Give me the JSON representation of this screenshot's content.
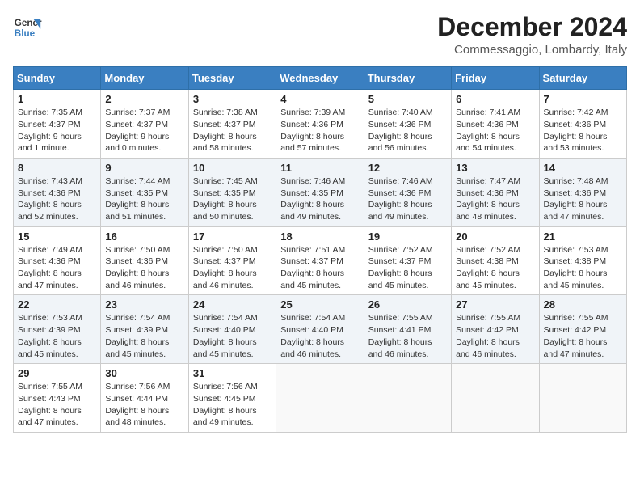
{
  "header": {
    "logo_line1": "General",
    "logo_line2": "Blue",
    "title": "December 2024",
    "subtitle": "Commessaggio, Lombardy, Italy"
  },
  "columns": [
    "Sunday",
    "Monday",
    "Tuesday",
    "Wednesday",
    "Thursday",
    "Friday",
    "Saturday"
  ],
  "weeks": [
    [
      {
        "day": "1",
        "sunrise": "7:35 AM",
        "sunset": "4:37 PM",
        "daylight": "9 hours and 1 minute."
      },
      {
        "day": "2",
        "sunrise": "7:37 AM",
        "sunset": "4:37 PM",
        "daylight": "9 hours and 0 minutes."
      },
      {
        "day": "3",
        "sunrise": "7:38 AM",
        "sunset": "4:37 PM",
        "daylight": "8 hours and 58 minutes."
      },
      {
        "day": "4",
        "sunrise": "7:39 AM",
        "sunset": "4:36 PM",
        "daylight": "8 hours and 57 minutes."
      },
      {
        "day": "5",
        "sunrise": "7:40 AM",
        "sunset": "4:36 PM",
        "daylight": "8 hours and 56 minutes."
      },
      {
        "day": "6",
        "sunrise": "7:41 AM",
        "sunset": "4:36 PM",
        "daylight": "8 hours and 54 minutes."
      },
      {
        "day": "7",
        "sunrise": "7:42 AM",
        "sunset": "4:36 PM",
        "daylight": "8 hours and 53 minutes."
      }
    ],
    [
      {
        "day": "8",
        "sunrise": "7:43 AM",
        "sunset": "4:36 PM",
        "daylight": "8 hours and 52 minutes."
      },
      {
        "day": "9",
        "sunrise": "7:44 AM",
        "sunset": "4:35 PM",
        "daylight": "8 hours and 51 minutes."
      },
      {
        "day": "10",
        "sunrise": "7:45 AM",
        "sunset": "4:35 PM",
        "daylight": "8 hours and 50 minutes."
      },
      {
        "day": "11",
        "sunrise": "7:46 AM",
        "sunset": "4:35 PM",
        "daylight": "8 hours and 49 minutes."
      },
      {
        "day": "12",
        "sunrise": "7:46 AM",
        "sunset": "4:36 PM",
        "daylight": "8 hours and 49 minutes."
      },
      {
        "day": "13",
        "sunrise": "7:47 AM",
        "sunset": "4:36 PM",
        "daylight": "8 hours and 48 minutes."
      },
      {
        "day": "14",
        "sunrise": "7:48 AM",
        "sunset": "4:36 PM",
        "daylight": "8 hours and 47 minutes."
      }
    ],
    [
      {
        "day": "15",
        "sunrise": "7:49 AM",
        "sunset": "4:36 PM",
        "daylight": "8 hours and 47 minutes."
      },
      {
        "day": "16",
        "sunrise": "7:50 AM",
        "sunset": "4:36 PM",
        "daylight": "8 hours and 46 minutes."
      },
      {
        "day": "17",
        "sunrise": "7:50 AM",
        "sunset": "4:37 PM",
        "daylight": "8 hours and 46 minutes."
      },
      {
        "day": "18",
        "sunrise": "7:51 AM",
        "sunset": "4:37 PM",
        "daylight": "8 hours and 45 minutes."
      },
      {
        "day": "19",
        "sunrise": "7:52 AM",
        "sunset": "4:37 PM",
        "daylight": "8 hours and 45 minutes."
      },
      {
        "day": "20",
        "sunrise": "7:52 AM",
        "sunset": "4:38 PM",
        "daylight": "8 hours and 45 minutes."
      },
      {
        "day": "21",
        "sunrise": "7:53 AM",
        "sunset": "4:38 PM",
        "daylight": "8 hours and 45 minutes."
      }
    ],
    [
      {
        "day": "22",
        "sunrise": "7:53 AM",
        "sunset": "4:39 PM",
        "daylight": "8 hours and 45 minutes."
      },
      {
        "day": "23",
        "sunrise": "7:54 AM",
        "sunset": "4:39 PM",
        "daylight": "8 hours and 45 minutes."
      },
      {
        "day": "24",
        "sunrise": "7:54 AM",
        "sunset": "4:40 PM",
        "daylight": "8 hours and 45 minutes."
      },
      {
        "day": "25",
        "sunrise": "7:54 AM",
        "sunset": "4:40 PM",
        "daylight": "8 hours and 46 minutes."
      },
      {
        "day": "26",
        "sunrise": "7:55 AM",
        "sunset": "4:41 PM",
        "daylight": "8 hours and 46 minutes."
      },
      {
        "day": "27",
        "sunrise": "7:55 AM",
        "sunset": "4:42 PM",
        "daylight": "8 hours and 46 minutes."
      },
      {
        "day": "28",
        "sunrise": "7:55 AM",
        "sunset": "4:42 PM",
        "daylight": "8 hours and 47 minutes."
      }
    ],
    [
      {
        "day": "29",
        "sunrise": "7:55 AM",
        "sunset": "4:43 PM",
        "daylight": "8 hours and 47 minutes."
      },
      {
        "day": "30",
        "sunrise": "7:56 AM",
        "sunset": "4:44 PM",
        "daylight": "8 hours and 48 minutes."
      },
      {
        "day": "31",
        "sunrise": "7:56 AM",
        "sunset": "4:45 PM",
        "daylight": "8 hours and 49 minutes."
      },
      null,
      null,
      null,
      null
    ]
  ],
  "labels": {
    "sunrise": "Sunrise:",
    "sunset": "Sunset:",
    "daylight": "Daylight:"
  }
}
